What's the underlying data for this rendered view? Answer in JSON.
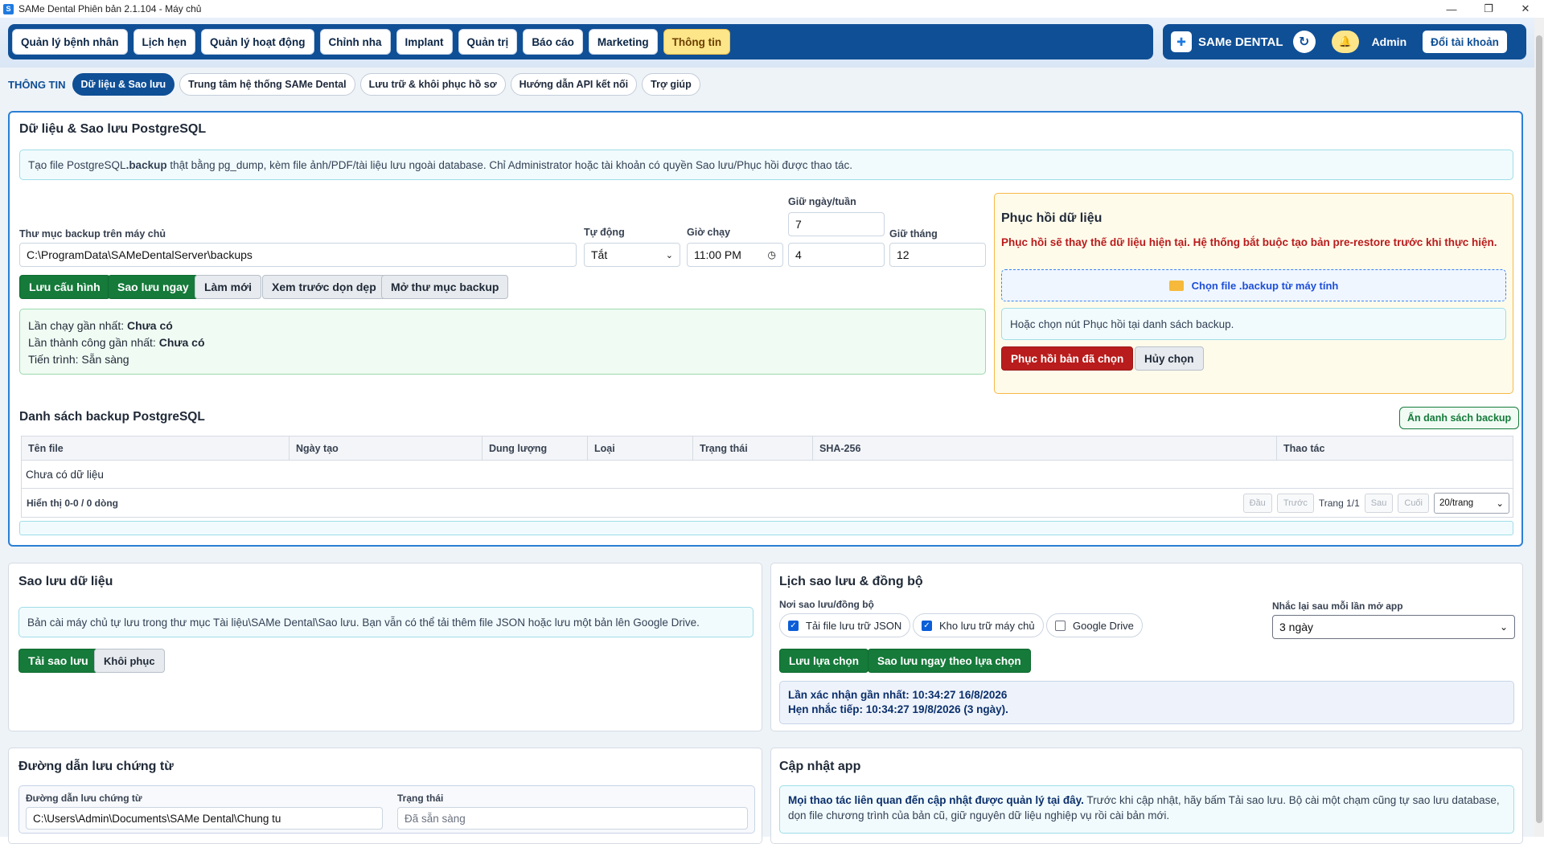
{
  "window": {
    "title": "SAMe Dental Phiên bản 2.1.104 - Máy chủ",
    "minimize": "—",
    "maximize": "❐",
    "close": "✕"
  },
  "nav": {
    "items": [
      "Quản lý bệnh nhân",
      "Lịch hẹn",
      "Quản lý hoạt động",
      "Chỉnh nha",
      "Implant",
      "Quản trị",
      "Báo cáo",
      "Marketing",
      "Thông tin"
    ],
    "active": "Thông tin",
    "brand": "SAMe DENTAL",
    "user": "Admin",
    "switch_account": "Đổi tài khoản"
  },
  "subnav": {
    "label": "THÔNG TIN",
    "tabs": [
      "Dữ liệu & Sao lưu",
      "Trung tâm hệ thống SAMe Dental",
      "Lưu trữ & khôi phục hồ sơ",
      "Hướng dẫn API kết nối",
      "Trợ giúp"
    ],
    "active": "Dữ liệu & Sao lưu"
  },
  "pg_backup": {
    "title": "Dữ liệu & Sao lưu PostgreSQL",
    "info_pre": "Tạo file PostgreSQL ",
    "info_bold": ".backup",
    "info_post": " thật bằng pg_dump, kèm file ảnh/PDF/tài liệu lưu ngoài database. Chỉ Administrator hoặc tài khoản có quyền Sao lưu/Phục hồi được thao tác.",
    "folder_label": "Thư mục backup trên máy chủ",
    "folder_value": "C:\\ProgramData\\SAMeDentalServer\\backups",
    "auto_label": "Tự động",
    "auto_value": "Tắt",
    "time_label": "Giờ chạy",
    "time_value": "11:00 PM",
    "keep_label": "Giữ ngày/tuần",
    "keep_day": "7",
    "keep_week": "4",
    "keep_month_label": "Giữ tháng",
    "keep_month": "12",
    "buttons": {
      "save_config": "Lưu cấu hình",
      "backup_now": "Sao lưu ngay",
      "refresh": "Làm mới",
      "preview_cleanup": "Xem trước dọn dẹp",
      "open_folder": "Mở thư mục backup"
    },
    "status": {
      "last_run_label": "Lần chạy gần nhất: ",
      "last_run": "Chưa có",
      "last_success_label": "Lần thành công gần nhất: ",
      "last_success": "Chưa có",
      "progress": "Tiến trình: Sẵn sàng"
    },
    "restore": {
      "title": "Phục hồi dữ liệu",
      "warning": "Phục hồi sẽ thay thế dữ liệu hiện tại. Hệ thống bắt buộc tạo bản pre-restore trước khi thực hiện.",
      "choose_file": "Chọn file .backup từ máy tính",
      "hint": "Hoặc chọn nút Phục hồi tại danh sách backup.",
      "restore_selected": "Phục hồi bản đã chọn",
      "cancel": "Hủy chọn"
    },
    "list_title": "Danh sách backup PostgreSQL",
    "hide_list": "Ẩn danh sách backup",
    "columns": [
      "Tên file",
      "Ngày tạo",
      "Dung lượng",
      "Loại",
      "Trạng thái",
      "SHA-256",
      "Thao tác"
    ],
    "empty": "Chưa có dữ liệu",
    "showing": "Hiển thị 0-0 / 0 dòng",
    "pager": {
      "first": "Đầu",
      "prev": "Trước",
      "page": "Trang 1/1",
      "next": "Sau",
      "last": "Cuối",
      "per_page": "20/trang"
    }
  },
  "data_backup": {
    "title": "Sao lưu dữ liệu",
    "info": "Bản cài máy chủ tự lưu trong thư mục Tài liệu\\SAMe Dental\\Sao lưu. Bạn vẫn có thể tải thêm file JSON hoặc lưu một bản lên Google Drive.",
    "download": "Tải sao lưu",
    "restore": "Khôi phục"
  },
  "sync": {
    "title": "Lịch sao lưu & đồng bộ",
    "where_label": "Nơi sao lưu/đồng bộ",
    "options": [
      {
        "label": "Tải file lưu trữ JSON",
        "checked": true
      },
      {
        "label": "Kho lưu trữ máy chủ",
        "checked": true
      },
      {
        "label": "Google Drive",
        "checked": false
      }
    ],
    "remind_label": "Nhắc lại sau mỗi lần mở app",
    "remind_value": "3 ngày",
    "save_choice": "Lưu lựa chọn",
    "backup_by_choice": "Sao lưu ngay theo lựa chọn",
    "last_confirm": "Lần xác nhận gần nhất: 10:34:27 16/8/2026",
    "next_reminder": "Hẹn nhắc tiếp: 10:34:27 19/8/2026 (3 ngày)."
  },
  "voucher": {
    "title": "Đường dẫn lưu chứng từ",
    "path_label": "Đường dẫn lưu chứng từ",
    "path_value": "C:\\Users\\Admin\\Documents\\SAMe Dental\\Chung tu",
    "status_label": "Trạng thái",
    "status_placeholder": "Đã sẵn sàng"
  },
  "update": {
    "title": "Cập nhật app",
    "info_bold": "Mọi thao tác liên quan đến cập nhật được quản lý tại đây.",
    "info_rest": " Trước khi cập nhật, hãy bấm Tải sao lưu. Bộ cài một chạm cũng tự sao lưu database, dọn file chương trình của bản cũ, giữ nguyên dữ liệu nghiệp vụ rồi cài bản mới."
  }
}
